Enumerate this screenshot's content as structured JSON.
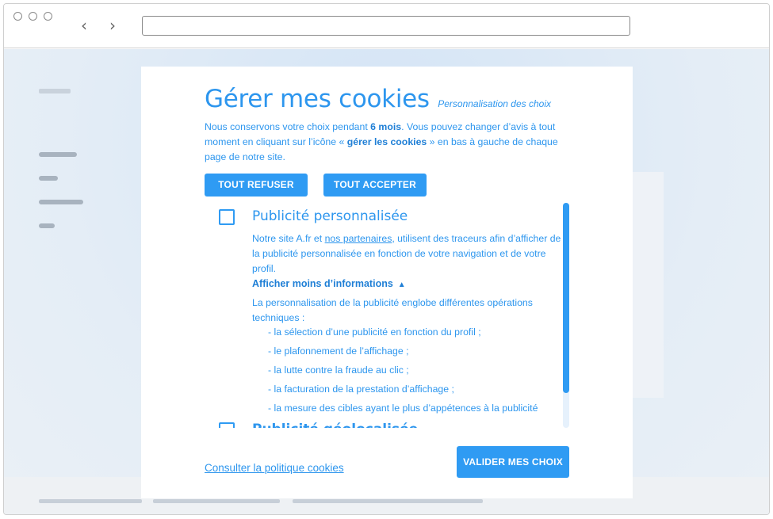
{
  "modal": {
    "title": "Gérer mes cookies",
    "subtitle": "Personnalisation des choix",
    "intro": {
      "part1": "Nous conservons votre choix pendant ",
      "duration": "6 mois",
      "part2": ". Vous pouvez changer d’avis à tout moment en cliquant sur l’icône « ",
      "icon_name": "gérer les cookies",
      "part3": " » en bas à gauche de chaque page de notre site."
    },
    "refuse_all_label": "TOUT REFUSER",
    "accept_all_label": "TOUT ACCEPTER",
    "categories": [
      {
        "title": "Publicité personnalisée",
        "desc_part1": "Notre site A.fr et ",
        "desc_link": "nos partenaires",
        "desc_part2": ", utilisent des traceurs afin d’afficher de la publicité personnalisée en fonction de votre navigation et de votre profil.",
        "toggle_label": "Afficher moins d’informations",
        "details_intro": "La personnalisation de la publicité englobe différentes opérations techniques :",
        "details": [
          "- la sélection d’une publicité en fonction du profil ;",
          "- le plafonnement de l’affichage ;",
          "- la lutte contre la fraude au clic ;",
          "- la facturation de la prestation d’affichage ;",
          "- la mesure des cibles ayant le plus d’appétences à la publicité"
        ],
        "checked": false
      },
      {
        "title": "Publicité géolocalisée",
        "checked": false
      }
    ],
    "policy_link": "Consulter la politique cookies",
    "validate_label": "VALIDER MES CHOIX"
  },
  "colors": {
    "accent": "#2f9bf3",
    "text": "#2d96ee",
    "backdrop": "#e4edf6"
  },
  "icons": {
    "back": "chevron-left-icon",
    "forward": "chevron-right-icon",
    "toggle": "chevron-up-icon"
  }
}
